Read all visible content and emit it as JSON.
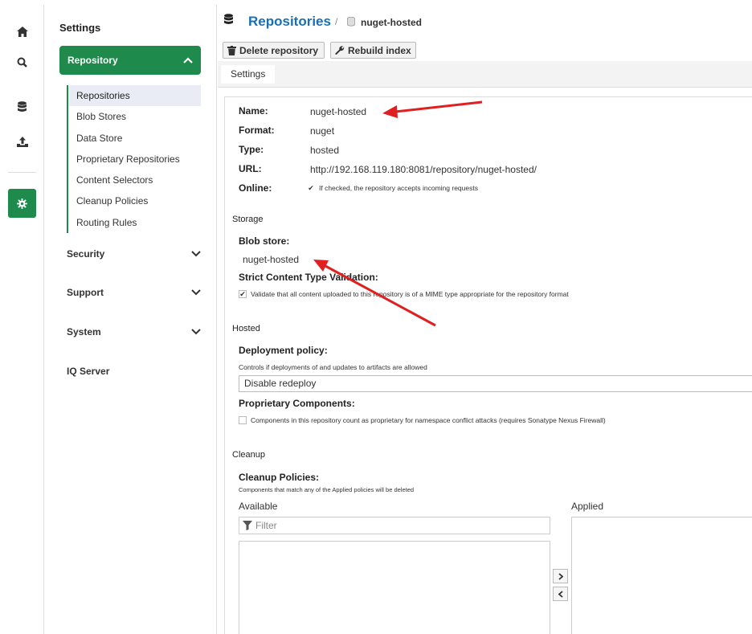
{
  "nav": {
    "home_icon": "home-icon",
    "search_icon": "search-icon",
    "browse_icon": "database-icon",
    "upload_icon": "upload-icon",
    "admin_icon": "gear-icon"
  },
  "sidebar": {
    "title": "Settings",
    "repository_label": "Repository",
    "items": [
      {
        "label": "Repositories"
      },
      {
        "label": "Blob Stores"
      },
      {
        "label": "Data Store"
      },
      {
        "label": "Proprietary Repositories"
      },
      {
        "label": "Content Selectors"
      },
      {
        "label": "Cleanup Policies"
      },
      {
        "label": "Routing Rules"
      }
    ],
    "sections": [
      {
        "label": "Security"
      },
      {
        "label": "Support"
      },
      {
        "label": "System"
      },
      {
        "label": "IQ Server"
      }
    ]
  },
  "header": {
    "title": "Repositories",
    "separator": "/",
    "current": "nuget-hosted"
  },
  "toolbar": {
    "delete_label": "Delete repository",
    "rebuild_label": "Rebuild index"
  },
  "tabs": [
    {
      "label": "Settings"
    }
  ],
  "form": {
    "name_label": "Name:",
    "name_value": "nuget-hosted",
    "format_label": "Format:",
    "format_value": "nuget",
    "type_label": "Type:",
    "type_value": "hosted",
    "url_label": "URL:",
    "url_value": "http://192.168.119.180:8081/repository/nuget-hosted/",
    "online_label": "Online:",
    "online_help": "If checked, the repository accepts incoming requests",
    "storage_section": "Storage",
    "blob_store_label": "Blob store:",
    "blob_store_value": "nuget-hosted",
    "strict_label": "Strict Content Type Validation:",
    "strict_help": "Validate that all content uploaded to this repository is of a MIME type appropriate for the repository format",
    "hosted_section": "Hosted",
    "deployment_label": "Deployment policy:",
    "deployment_help": "Controls if deployments of and updates to artifacts are allowed",
    "deployment_value": "Disable redeploy",
    "proprietary_label": "Proprietary Components:",
    "proprietary_help": "Components in this repository count as proprietary for namespace conflict attacks (requires Sonatype Nexus Firewall)",
    "cleanup_section": "Cleanup",
    "cleanup_label": "Cleanup Policies:",
    "cleanup_help": "Components that match any of the Applied policies will be deleted",
    "available_label": "Available",
    "applied_label": "Applied",
    "filter_placeholder": "Filter"
  },
  "colors": {
    "accent_green": "#1e8a4c",
    "link_blue": "#1a6fb5",
    "annotation_red": "#e02020"
  }
}
